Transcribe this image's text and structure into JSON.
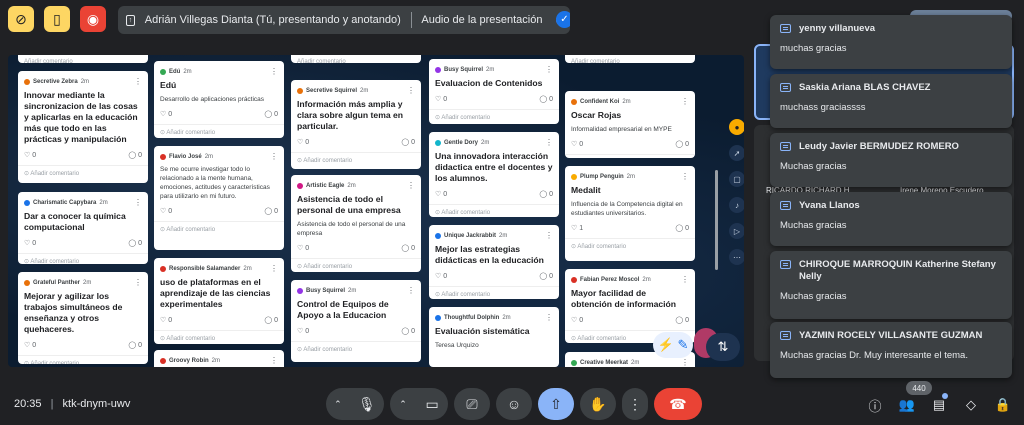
{
  "presentation": {
    "presenter": "Adrián Villegas Dianta (Tú, presentando y anotando)",
    "audio_label": "Audio de la presentación"
  },
  "board": {
    "comment_label": "Añadir comentario",
    "columns": [
      [
        {
          "author": "Secretive Zebra",
          "time": "2m",
          "color": "#e8710a",
          "title": "Innovar mediante la sincronizacion de las cosas y aplicarlas en la educación más que todo en las prácticas y manipulación",
          "body": "",
          "likes": "0",
          "comments": "0"
        },
        {
          "author": "Charismatic Capybara",
          "time": "2m",
          "color": "#1a73e8",
          "title": "Dar a conocer la química computacional",
          "body": "",
          "likes": "0",
          "comments": "0"
        },
        {
          "author": "Grateful Panther",
          "time": "2m",
          "color": "#e8710a",
          "title": "Mejorar y agilizar los trabajos simultáneos de enseñanza y otros quehaceres.",
          "body": "",
          "likes": "0",
          "comments": "0"
        }
      ],
      [
        {
          "author": "Edú",
          "time": "2m",
          "color": "#34a853",
          "title": "Edú",
          "body": "Desarrollo de aplicaciones prácticas",
          "likes": "0",
          "comments": "0"
        },
        {
          "author": "Flavio José",
          "time": "2m",
          "color": "#d93025",
          "title": "",
          "body": "Se me ocurre investigar todo lo relacionado a la mente humana, emociones, actitudes y características para utilizarlo en mi futuro.",
          "likes": "0",
          "comments": "0"
        },
        {
          "author": "Responsible Salamander",
          "time": "2m",
          "color": "#d93025",
          "title": "uso de plataformas en el aprendizaje de las ciencias experimentales",
          "body": "",
          "likes": "0",
          "comments": "0"
        },
        {
          "author": "Groovy Robin",
          "time": "2m",
          "color": "#d93025",
          "title": "",
          "body": "",
          "likes": "",
          "comments": ""
        }
      ],
      [
        {
          "author": "Secretive Squirrel",
          "time": "2m",
          "color": "#e8710a",
          "title": "Información más amplia y clara sobre algun tema en particular.",
          "body": "",
          "likes": "0",
          "comments": "0"
        },
        {
          "author": "Artistic Eagle",
          "time": "2m",
          "color": "#d01884",
          "title": "Asistencia de todo el personal de una empresa",
          "body": "Asistencia de todo el personal de una empresa",
          "likes": "0",
          "comments": "0"
        },
        {
          "author": "Busy Squirrel",
          "time": "2m",
          "color": "#9334e6",
          "title": "Control de Equipos de Apoyo a la Educacion",
          "body": "",
          "likes": "0",
          "comments": "0"
        }
      ],
      [
        {
          "author": "Busy Squirrel",
          "time": "2m",
          "color": "#9334e6",
          "title": "Evaluacion de Contenidos",
          "body": "",
          "likes": "0",
          "comments": "0"
        },
        {
          "author": "Gentle Dory",
          "time": "2m",
          "color": "#12b5cb",
          "title": "Una innovadora interacción didactica entre el docentes y los alumnos.",
          "body": "",
          "likes": "0",
          "comments": "0"
        },
        {
          "author": "Unique Jackrabbit",
          "time": "2m",
          "color": "#1a73e8",
          "title": "Mejor las estrategias didácticas en la educación",
          "body": "",
          "likes": "0",
          "comments": "0"
        },
        {
          "author": "Thoughtful Dolphin",
          "time": "2m",
          "color": "#1a73e8",
          "title": "Evaluación sistemática",
          "body": "Teresa Urquizo",
          "likes": "",
          "comments": ""
        }
      ],
      [
        {
          "author": "Confident Koi",
          "time": "2m",
          "color": "#e8710a",
          "title": "Oscar Rojas",
          "body": "Informalidad empresarial en MYPE",
          "likes": "0",
          "comments": "0"
        },
        {
          "author": "Plump Penguin",
          "time": "2m",
          "color": "#f9ab00",
          "title": "Medalit",
          "body": "Influencia de la Competencia digital en estudiantes universitarios.",
          "likes": "1",
          "comments": "0"
        },
        {
          "author": "Fabian Perez Moscol",
          "time": "2m",
          "color": "#d93025",
          "title": "Mayor facilidad de obtención de información",
          "body": "",
          "likes": "0",
          "comments": "0"
        },
        {
          "author": "Creative Meerkat",
          "time": "2m",
          "color": "#34a853",
          "title": "",
          "body": "",
          "likes": "",
          "comments": ""
        }
      ]
    ]
  },
  "participants": {
    "tile_a": "RICARDO RICHARD H...",
    "tile_b": "Irene Moreno Escudero"
  },
  "chat": [
    {
      "name": "yenny villanueva",
      "message": "muchas gracias"
    },
    {
      "name": "Saskia Ariana BLAS CHAVEZ",
      "message": "muchass graciassss"
    },
    {
      "name": "Leudy Javier BERMUDEZ ROMERO",
      "message": "Muchas gracias"
    },
    {
      "name": "Yvana Llanos",
      "message": "Muchas gracias"
    },
    {
      "name": "CHIROQUE MARROQUIN Katherine Stefany Nelly",
      "message": "Muchas gracias"
    },
    {
      "name": "YAZMIN ROCELY VILLASANTE GUZMAN",
      "message": "Muchas gracias Dr. Muy interesante el tema."
    }
  ],
  "bottom": {
    "time": "20:35",
    "separator": "|",
    "meeting_code": "ktk-dnym-uwv",
    "participant_count": "440"
  },
  "colors": {
    "accent": "#8ab4f8",
    "end_call": "#ea4335",
    "present_active": "#8ab4f8"
  }
}
